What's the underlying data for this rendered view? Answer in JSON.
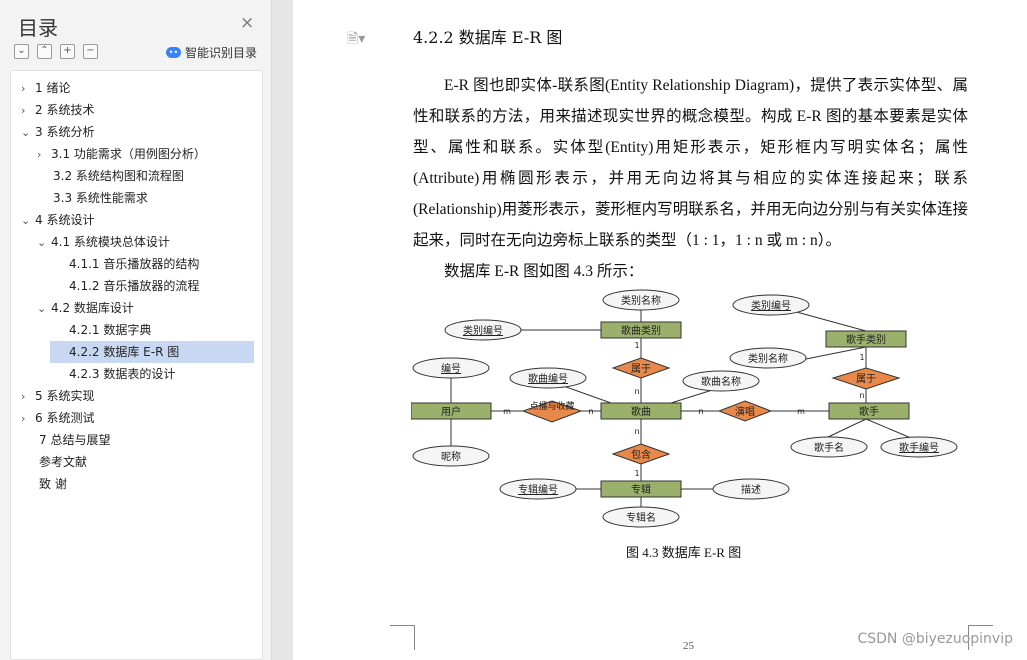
{
  "sidebar": {
    "title": "目录",
    "close": "×",
    "tools": [
      "⌄",
      "⌃",
      "+",
      "−"
    ],
    "ai_label": "智能识别目录",
    "items": [
      {
        "label": "1 绪论",
        "arrow": "›"
      },
      {
        "label": "2 系统技术",
        "arrow": "›"
      },
      {
        "label": "3 系统分析",
        "arrow": "⌄"
      },
      {
        "label": "3.1  功能需求（用例图分析）",
        "arrow": "›"
      },
      {
        "label": "3.2  系统结构图和流程图",
        "arrow": ""
      },
      {
        "label": "3.3  系统性能需求",
        "arrow": ""
      },
      {
        "label": "4 系统设计",
        "arrow": "⌄"
      },
      {
        "label": "4.1  系统模块总体设计",
        "arrow": "⌄"
      },
      {
        "label": "4.1.1  音乐播放器的结构",
        "arrow": ""
      },
      {
        "label": "4.1.2  音乐播放器的流程",
        "arrow": ""
      },
      {
        "label": "4.2  数据库设计",
        "arrow": "⌄"
      },
      {
        "label": "4.2.1  数据字典",
        "arrow": ""
      },
      {
        "label": "4.2.2  数据库 E-R 图",
        "arrow": ""
      },
      {
        "label": "4.2.3  数据表的设计",
        "arrow": ""
      },
      {
        "label": "5 系统实现",
        "arrow": "›"
      },
      {
        "label": "6 系统测试",
        "arrow": "›"
      },
      {
        "label": "7 总结与展望",
        "arrow": ""
      },
      {
        "label": "参考文献",
        "arrow": ""
      },
      {
        "label": "致    谢",
        "arrow": ""
      }
    ]
  },
  "document": {
    "heading": "4.2.2  数据库 E-R 图",
    "paragraph1": "E-R 图也即实体-联系图(Entity Relationship Diagram)，提供了表示实体型、属性和联系的方法，用来描述现实世界的概念模型。构成 E-R 图的基本要素是实体型、属性和联系。实体型(Entity)用矩形表示，矩形框内写明实体名；属性(Attribute)用椭圆形表示，并用无向边将其与相应的实体连接起来；联系(Relationship)用菱形表示，菱形框内写明联系名，并用无向边分别与有关实体连接起来，同时在无向边旁标上联系的类型（1 : 1，1 : n 或 m : n）。",
    "paragraph2": "数据库 E-R 图如图 4.3 所示：",
    "caption": "图 4.3 数据库 E-R 图",
    "page_number": "25",
    "doc_icon": "🗎▾"
  },
  "er": {
    "entities": {
      "user": "用户",
      "song": "歌曲",
      "song_category": "歌曲类别",
      "singer_category": "歌手类别",
      "singer": "歌手",
      "album": "专辑"
    },
    "relations": {
      "belong1": "属于",
      "collect": "点播与收藏",
      "perform": "演唱",
      "belong2": "属于",
      "contain": "包含"
    },
    "attributes": {
      "cat_name": "类别名称",
      "cat_id": "类别编号",
      "singer_cat_id": "类别编号",
      "singer_cat_name": "类别名称",
      "user_id": "编号",
      "nickname": "昵称",
      "song_id": "歌曲编号",
      "song_name": "歌曲名称",
      "singer_name": "歌手名",
      "singer_id": "歌手编号",
      "album_id": "专辑编号",
      "desc": "描述",
      "album_name": "专辑名"
    },
    "cardinality": {
      "one": "1",
      "n": "n",
      "m": "m"
    }
  },
  "watermark": "CSDN @biyezuopinvip"
}
